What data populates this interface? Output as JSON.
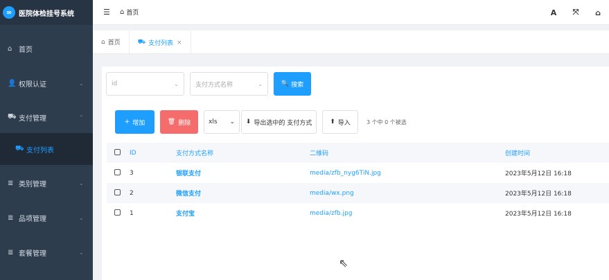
{
  "app": {
    "title": "医院体检挂号系统",
    "logo_glyph": "∞"
  },
  "header": {
    "menu_icon": "☰",
    "breadcrumb_icon": "⌂",
    "breadcrumb": "首页",
    "right_icons": [
      "A",
      "⤧",
      "⌂"
    ]
  },
  "sidebar": {
    "items": [
      {
        "label": "首页",
        "icon": "⌂",
        "arrow": ""
      },
      {
        "label": "权限认证",
        "icon": "👤",
        "arrow": "⌄"
      },
      {
        "label": "支付管理",
        "icon": "⛟",
        "arrow": "⌃"
      },
      {
        "label": "支付列表",
        "icon": "⛟",
        "arrow": ""
      },
      {
        "label": "类别管理",
        "icon": "≣",
        "arrow": "⌄"
      },
      {
        "label": "品项管理",
        "icon": "≣",
        "arrow": "⌄"
      },
      {
        "label": "套餐管理",
        "icon": "≣",
        "arrow": "⌄"
      }
    ]
  },
  "tabs": [
    {
      "label": "首页",
      "icon": "⌂"
    },
    {
      "label": "支付列表",
      "icon": "⛟",
      "close": "×"
    }
  ],
  "search": {
    "id_placeholder": "id",
    "name_placeholder": "支付方式名称",
    "chevron": "⌄",
    "button_icon": "🔍",
    "button_label": "搜索"
  },
  "toolbar": {
    "add_icon": "+",
    "add_label": "增加",
    "delete_icon": "🗑",
    "delete_label": "删除",
    "format_value": "xls",
    "format_chevron": "⌄",
    "export_icon": "⬇",
    "export_label": "导出选中的 支付方式",
    "import_icon": "⬆",
    "import_label": "导入",
    "selection_info": "3 个中 0 个被选"
  },
  "table": {
    "columns": [
      "ID",
      "支付方式名称",
      "二维码",
      "创建时间"
    ],
    "rows": [
      {
        "id": "3",
        "name": "银联支付",
        "qr": "media/zfb_nyg6TiN.jpg",
        "created": "2023年5月12日 16:18"
      },
      {
        "id": "2",
        "name": "微信支付",
        "qr": "media/wx.png",
        "created": "2023年5月12日 16:18"
      },
      {
        "id": "1",
        "name": "支付宝",
        "qr": "media/zfb.jpg",
        "created": "2023年5月12日 16:18"
      }
    ]
  },
  "colors": {
    "accent": "#1e9fff",
    "danger": "#f56c6c",
    "sidebar_bg": "#2e3d4d"
  }
}
